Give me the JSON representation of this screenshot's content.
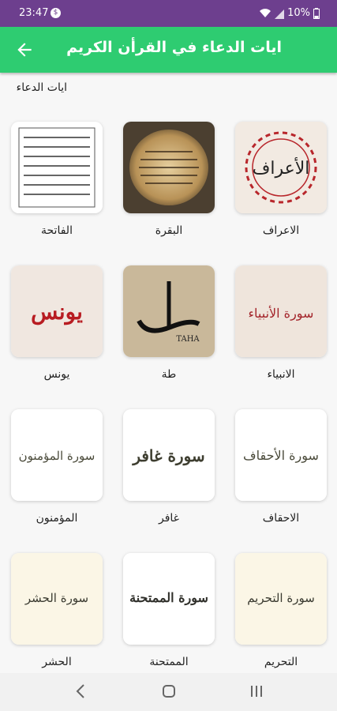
{
  "status": {
    "time": "23:47",
    "battery": "10%"
  },
  "appbar": {
    "title": "ايات الدعاء في القرأن الكريم"
  },
  "section": {
    "label": "ايات الدعاء"
  },
  "items": [
    {
      "label": "الاعراف",
      "art_text": "الأعراف"
    },
    {
      "label": "البقرة",
      "art_text": ""
    },
    {
      "label": "الفاتحة",
      "art_text": ""
    },
    {
      "label": "الانبياء",
      "art_text": "سورة الأنبياء"
    },
    {
      "label": "طة",
      "art_text": "TAHA"
    },
    {
      "label": "يونس",
      "art_text": "يونس"
    },
    {
      "label": "الاحقاف",
      "art_text": "سورة الأحقاف"
    },
    {
      "label": "غافر",
      "art_text": "سورة غافر"
    },
    {
      "label": "المؤمنون",
      "art_text": "سورة المؤمنون"
    },
    {
      "label": "التحريم",
      "art_text": "سورة التحريم"
    },
    {
      "label": "الممتحنة",
      "art_text": "سورة الممتحنة"
    },
    {
      "label": "الحشر",
      "art_text": "سورة الحشر"
    }
  ]
}
